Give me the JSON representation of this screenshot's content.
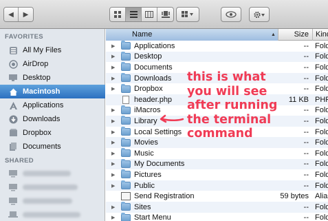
{
  "toolbar": {
    "nav": [
      "back",
      "forward"
    ],
    "views": [
      "icon-view",
      "list-view",
      "column-view",
      "coverflow-view"
    ],
    "arrange": "arrange",
    "quicklook": "eye",
    "action": "gear"
  },
  "sidebar": {
    "favorites_label": "FAVORITES",
    "favorites": [
      {
        "label": "All My Files",
        "icon": "all-files-icon"
      },
      {
        "label": "AirDrop",
        "icon": "airdrop-icon"
      },
      {
        "label": "Desktop",
        "icon": "desktop-icon"
      },
      {
        "label": "Macintosh",
        "icon": "home-icon",
        "selected": true
      },
      {
        "label": "Applications",
        "icon": "applications-icon"
      },
      {
        "label": "Downloads",
        "icon": "downloads-icon"
      },
      {
        "label": "Dropbox",
        "icon": "dropbox-icon"
      },
      {
        "label": "Documents",
        "icon": "documents-icon"
      }
    ],
    "shared_label": "SHARED",
    "shared_count": 4
  },
  "columns": {
    "name": "Name",
    "size": "Size",
    "kind": "Kind"
  },
  "rows": [
    {
      "name": "Applications",
      "size": "--",
      "kind": "Folde",
      "type": "folder"
    },
    {
      "name": "Desktop",
      "size": "--",
      "kind": "Folde",
      "type": "folder"
    },
    {
      "name": "Documents",
      "size": "--",
      "kind": "Folde",
      "type": "folder"
    },
    {
      "name": "Downloads",
      "size": "--",
      "kind": "Folde",
      "type": "folder"
    },
    {
      "name": "Dropbox",
      "size": "--",
      "kind": "Folde",
      "type": "folder"
    },
    {
      "name": "header.php",
      "size": "11 KB",
      "kind": "PHP:",
      "type": "doc"
    },
    {
      "name": "iMacros",
      "size": "--",
      "kind": "Folde",
      "type": "folder"
    },
    {
      "name": "Library",
      "size": "--",
      "kind": "Folde",
      "type": "folder"
    },
    {
      "name": "Local Settings",
      "size": "--",
      "kind": "Folde",
      "type": "folder"
    },
    {
      "name": "Movies",
      "size": "--",
      "kind": "Folde",
      "type": "folder"
    },
    {
      "name": "Music",
      "size": "--",
      "kind": "Folde",
      "type": "folder"
    },
    {
      "name": "My Documents",
      "size": "--",
      "kind": "Folde",
      "type": "folder"
    },
    {
      "name": "Pictures",
      "size": "--",
      "kind": "Folde",
      "type": "folder"
    },
    {
      "name": "Public",
      "size": "--",
      "kind": "Folde",
      "type": "folder"
    },
    {
      "name": "Send Registration",
      "size": "59 bytes",
      "kind": "Alias",
      "type": "alias"
    },
    {
      "name": "Sites",
      "size": "--",
      "kind": "Folde",
      "type": "folder"
    },
    {
      "name": "Start Menu",
      "size": "--",
      "kind": "Folde",
      "type": "folder"
    }
  ],
  "annotation": {
    "lines": [
      "this is what",
      "you will see",
      "after running",
      "the terminal",
      "command"
    ],
    "color": "#f03b55"
  }
}
